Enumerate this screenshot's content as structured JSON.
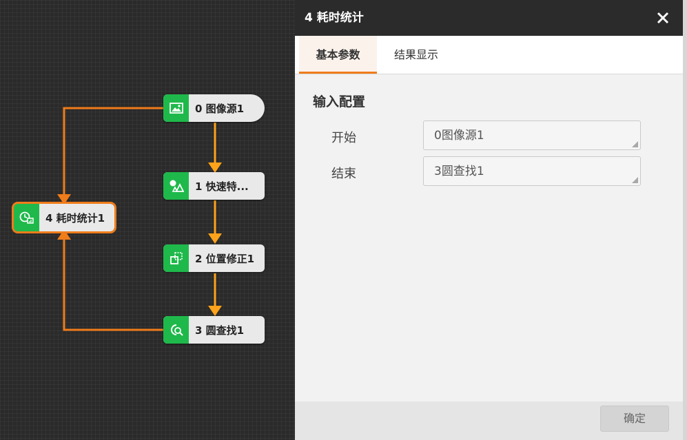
{
  "canvas": {
    "nodes": [
      {
        "label": "0 图像源1",
        "icon": "image-icon"
      },
      {
        "label": "1 快速特...",
        "icon": "feature-match-icon"
      },
      {
        "label": "2 位置修正1",
        "icon": "position-correction-icon"
      },
      {
        "label": "3 圆查找1",
        "icon": "circle-find-icon"
      },
      {
        "label": "4 耗时统计1",
        "icon": "timer-stat-icon"
      }
    ],
    "colors": {
      "node_icon_bg": "#1fb94b",
      "link_orange": "#f07c1a",
      "flow_arrow": "#ffa31a"
    }
  },
  "panel": {
    "title": "4 耗时统计",
    "close_icon": "close-icon",
    "tabs": [
      {
        "label": "基本参数",
        "active": true
      },
      {
        "label": "结果显示",
        "active": false
      }
    ],
    "section_title": "输入配置",
    "fields": [
      {
        "label": "开始",
        "value": "0图像源1"
      },
      {
        "label": "结束",
        "value": "3圆查找1"
      }
    ],
    "ok_label": "确定",
    "accent": "#f07c1a"
  }
}
